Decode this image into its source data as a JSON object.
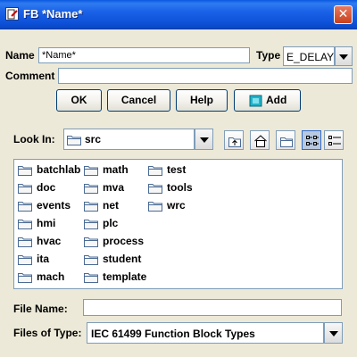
{
  "window": {
    "title": "FB *Name*",
    "close_glyph": "✕"
  },
  "form": {
    "name_label": "Name",
    "name_value": "*Name*",
    "type_label": "Type",
    "type_value": "E_DELAY",
    "comment_label": "Comment",
    "comment_value": ""
  },
  "buttons": {
    "ok": "OK",
    "cancel": "Cancel",
    "help": "Help",
    "add": "Add"
  },
  "chooser": {
    "look_in_label": "Look In:",
    "look_in_value": "src",
    "items": [
      "batchlab",
      "doc",
      "events",
      "hmi",
      "hvac",
      "ita",
      "mach",
      "math",
      "mva",
      "net",
      "plc",
      "process",
      "student",
      "template",
      "test",
      "tools",
      "wrc"
    ],
    "file_name_label": "File Name:",
    "file_name_value": "",
    "file_type_label": "Files of Type:",
    "file_type_value": "IEC 61499 Function Block Types"
  },
  "icons": {
    "window": "app-window-icon",
    "close": "close-icon",
    "add": "add-block-icon",
    "up": "up-folder-icon",
    "home": "home-icon",
    "new_folder": "new-folder-icon",
    "list": "list-view-icon",
    "details": "details-view-icon",
    "folder": "folder-icon"
  },
  "colors": {
    "title_bar": "#0b4fd6",
    "window_bg": "#ece9d8",
    "add_icon": "#1fb3c8"
  }
}
